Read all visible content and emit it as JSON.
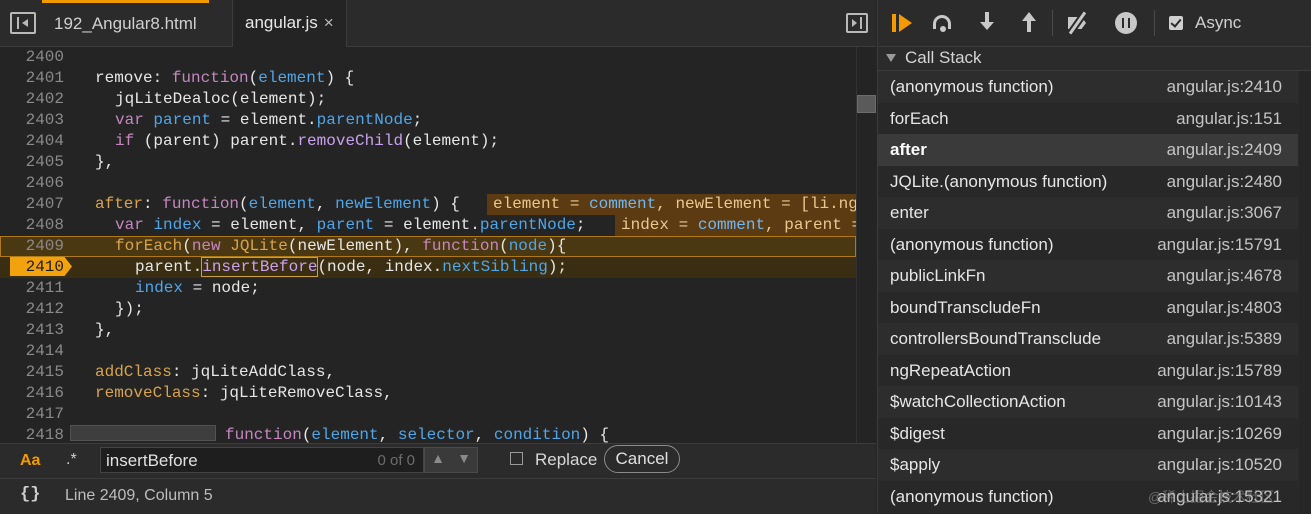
{
  "tabs": [
    {
      "label": "192_Angular8.html"
    },
    {
      "label": "angular.js",
      "close": "×"
    }
  ],
  "code_lines": [
    {
      "num": "2400"
    },
    {
      "num": "2401"
    },
    {
      "num": "2402"
    },
    {
      "num": "2403"
    },
    {
      "num": "2404"
    },
    {
      "num": "2405"
    },
    {
      "num": "2406"
    },
    {
      "num": "2407"
    },
    {
      "num": "2408"
    },
    {
      "num": "2409"
    },
    {
      "num": "2410"
    },
    {
      "num": "2411"
    },
    {
      "num": "2412"
    },
    {
      "num": "2413"
    },
    {
      "num": "2414"
    },
    {
      "num": "2415"
    },
    {
      "num": "2416"
    },
    {
      "num": "2417"
    },
    {
      "num": "2418"
    }
  ],
  "code": {
    "l2401": [
      "remove",
      ": ",
      "function",
      "(",
      "element",
      ") {"
    ],
    "l2402": "jqLiteDealoc(element);",
    "l2403": [
      "var",
      " ",
      "parent",
      " = element.",
      "parentNode",
      ";"
    ],
    "l2404": [
      "if",
      " (parent) parent.",
      "removeChild",
      "(element);"
    ],
    "l2405": "},",
    "l2407": [
      "after",
      ": ",
      "function",
      "(",
      "element",
      ", ",
      "newElement",
      ") {"
    ],
    "l2407_inline": [
      "element",
      " = ",
      "comment",
      ", ",
      "newElement",
      " = [li.ng-"
    ],
    "l2408": [
      "var",
      " ",
      "index",
      " = element, ",
      "parent",
      " = element.",
      "parentNode",
      ";"
    ],
    "l2408_inline": [
      "index",
      " = ",
      "comment",
      ", parent = "
    ],
    "l2409": [
      "forEach",
      "(",
      "new",
      " ",
      "JQLite",
      "(newElement), ",
      "function",
      "(",
      "node",
      "){"
    ],
    "l2410": [
      "parent.",
      "insertBefore",
      "(node, index.",
      "nextSibling",
      ");"
    ],
    "l2411": [
      "index",
      " = node;"
    ],
    "l2412": "});",
    "l2413": "},",
    "l2415": [
      "addClass",
      ": jqLiteAddClass,"
    ],
    "l2416": [
      "removeClass",
      ": jqLiteRemoveClass,"
    ],
    "l2418": [
      "function",
      "(",
      "element",
      ", ",
      "selector",
      ", ",
      "condition",
      ") {"
    ]
  },
  "search": {
    "case_label": "Aa",
    "regex_label": ".*",
    "value": "insertBefore",
    "count": "0 of 0",
    "prev": "▲",
    "next": "▼",
    "replace_label": "Replace",
    "cancel_label": "Cancel"
  },
  "status": {
    "braces": "{}",
    "position": "Line 2409, Column 5"
  },
  "debugger": {
    "async_label": "Async"
  },
  "call_stack": {
    "title": "Call Stack",
    "frames": [
      {
        "fn": "(anonymous function)",
        "loc": "angular.js:2410"
      },
      {
        "fn": "forEach",
        "loc": "angular.js:151"
      },
      {
        "fn": "after",
        "loc": "angular.js:2409"
      },
      {
        "fn": "JQLite.(anonymous function)",
        "loc": "angular.js:2480"
      },
      {
        "fn": "enter",
        "loc": "angular.js:3067"
      },
      {
        "fn": "(anonymous function)",
        "loc": "angular.js:15791"
      },
      {
        "fn": "publicLinkFn",
        "loc": "angular.js:4678"
      },
      {
        "fn": "boundTranscludeFn",
        "loc": "angular.js:4803"
      },
      {
        "fn": "controllersBoundTransclude",
        "loc": "angular.js:5389"
      },
      {
        "fn": "ngRepeatAction",
        "loc": "angular.js:15789"
      },
      {
        "fn": "$watchCollectionAction",
        "loc": "angular.js:10143"
      },
      {
        "fn": "$digest",
        "loc": "angular.js:10269"
      },
      {
        "fn": "$apply",
        "loc": "angular.js:10520"
      },
      {
        "fn": "(anonymous function)",
        "loc": "angular.js:15321"
      }
    ]
  },
  "watermark": "@稀土掘金技术社区",
  "colors": {
    "accent": "#f29a00",
    "background": "#242424",
    "keyword": "#c586c0",
    "property": "#4fa6e8"
  }
}
